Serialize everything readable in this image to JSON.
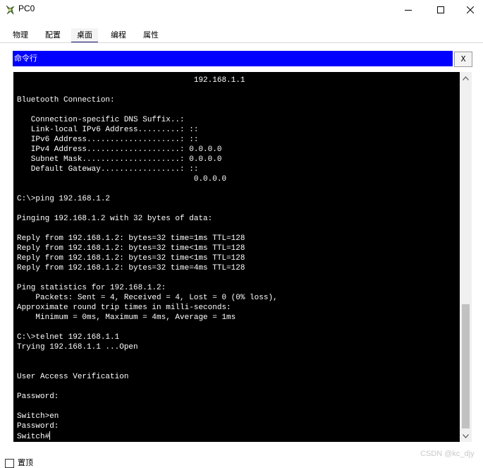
{
  "window": {
    "title": "PC0",
    "controls": {
      "minimize": "minimize-icon",
      "maximize": "maximize-icon",
      "close": "close-icon"
    }
  },
  "tabs": [
    {
      "label": "物理",
      "active": false
    },
    {
      "label": "配置",
      "active": false
    },
    {
      "label": "桌面",
      "active": true
    },
    {
      "label": "编程",
      "active": false
    },
    {
      "label": "属性",
      "active": false
    }
  ],
  "command_prompt": {
    "title": "命令行",
    "close_label": "X",
    "output": "                                      192.168.1.1\n\nBluetooth Connection:\n\n   Connection-specific DNS Suffix..:\n   Link-local IPv6 Address.........: ::\n   IPv6 Address....................: ::\n   IPv4 Address....................: 0.0.0.0\n   Subnet Mask.....................: 0.0.0.0\n   Default Gateway.................: ::\n                                      0.0.0.0\n\nC:\\>ping 192.168.1.2\n\nPinging 192.168.1.2 with 32 bytes of data:\n\nReply from 192.168.1.2: bytes=32 time=1ms TTL=128\nReply from 192.168.1.2: bytes=32 time<1ms TTL=128\nReply from 192.168.1.2: bytes=32 time<1ms TTL=128\nReply from 192.168.1.2: bytes=32 time=4ms TTL=128\n\nPing statistics for 192.168.1.2:\n    Packets: Sent = 4, Received = 4, Lost = 0 (0% loss),\nApproximate round trip times in milli-seconds:\n    Minimum = 0ms, Maximum = 4ms, Average = 1ms\n\nC:\\>telnet 192.168.1.1\nTrying 192.168.1.1 ...Open\n\n\nUser Access Verification\n\nPassword:\n\nSwitch>en\nPassword:\nSwitch#",
    "colors": {
      "header_bg": "#0000ff",
      "terminal_bg": "#000000",
      "terminal_fg": "#ffffff"
    }
  },
  "footer": {
    "checkbox_label": "置顶",
    "checkbox_checked": false,
    "watermark": "CSDN @kc_djy"
  }
}
